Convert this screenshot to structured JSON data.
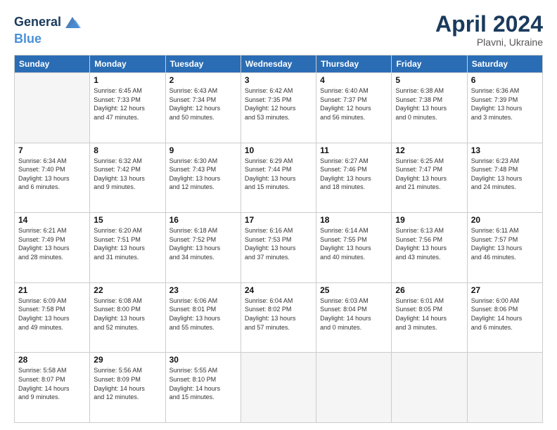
{
  "header": {
    "logo_line1": "General",
    "logo_line2": "Blue",
    "month": "April 2024",
    "location": "Plavni, Ukraine"
  },
  "weekdays": [
    "Sunday",
    "Monday",
    "Tuesday",
    "Wednesday",
    "Thursday",
    "Friday",
    "Saturday"
  ],
  "weeks": [
    [
      {
        "day": "",
        "info": ""
      },
      {
        "day": "1",
        "info": "Sunrise: 6:45 AM\nSunset: 7:33 PM\nDaylight: 12 hours\nand 47 minutes."
      },
      {
        "day": "2",
        "info": "Sunrise: 6:43 AM\nSunset: 7:34 PM\nDaylight: 12 hours\nand 50 minutes."
      },
      {
        "day": "3",
        "info": "Sunrise: 6:42 AM\nSunset: 7:35 PM\nDaylight: 12 hours\nand 53 minutes."
      },
      {
        "day": "4",
        "info": "Sunrise: 6:40 AM\nSunset: 7:37 PM\nDaylight: 12 hours\nand 56 minutes."
      },
      {
        "day": "5",
        "info": "Sunrise: 6:38 AM\nSunset: 7:38 PM\nDaylight: 13 hours\nand 0 minutes."
      },
      {
        "day": "6",
        "info": "Sunrise: 6:36 AM\nSunset: 7:39 PM\nDaylight: 13 hours\nand 3 minutes."
      }
    ],
    [
      {
        "day": "7",
        "info": "Sunrise: 6:34 AM\nSunset: 7:40 PM\nDaylight: 13 hours\nand 6 minutes."
      },
      {
        "day": "8",
        "info": "Sunrise: 6:32 AM\nSunset: 7:42 PM\nDaylight: 13 hours\nand 9 minutes."
      },
      {
        "day": "9",
        "info": "Sunrise: 6:30 AM\nSunset: 7:43 PM\nDaylight: 13 hours\nand 12 minutes."
      },
      {
        "day": "10",
        "info": "Sunrise: 6:29 AM\nSunset: 7:44 PM\nDaylight: 13 hours\nand 15 minutes."
      },
      {
        "day": "11",
        "info": "Sunrise: 6:27 AM\nSunset: 7:46 PM\nDaylight: 13 hours\nand 18 minutes."
      },
      {
        "day": "12",
        "info": "Sunrise: 6:25 AM\nSunset: 7:47 PM\nDaylight: 13 hours\nand 21 minutes."
      },
      {
        "day": "13",
        "info": "Sunrise: 6:23 AM\nSunset: 7:48 PM\nDaylight: 13 hours\nand 24 minutes."
      }
    ],
    [
      {
        "day": "14",
        "info": "Sunrise: 6:21 AM\nSunset: 7:49 PM\nDaylight: 13 hours\nand 28 minutes."
      },
      {
        "day": "15",
        "info": "Sunrise: 6:20 AM\nSunset: 7:51 PM\nDaylight: 13 hours\nand 31 minutes."
      },
      {
        "day": "16",
        "info": "Sunrise: 6:18 AM\nSunset: 7:52 PM\nDaylight: 13 hours\nand 34 minutes."
      },
      {
        "day": "17",
        "info": "Sunrise: 6:16 AM\nSunset: 7:53 PM\nDaylight: 13 hours\nand 37 minutes."
      },
      {
        "day": "18",
        "info": "Sunrise: 6:14 AM\nSunset: 7:55 PM\nDaylight: 13 hours\nand 40 minutes."
      },
      {
        "day": "19",
        "info": "Sunrise: 6:13 AM\nSunset: 7:56 PM\nDaylight: 13 hours\nand 43 minutes."
      },
      {
        "day": "20",
        "info": "Sunrise: 6:11 AM\nSunset: 7:57 PM\nDaylight: 13 hours\nand 46 minutes."
      }
    ],
    [
      {
        "day": "21",
        "info": "Sunrise: 6:09 AM\nSunset: 7:58 PM\nDaylight: 13 hours\nand 49 minutes."
      },
      {
        "day": "22",
        "info": "Sunrise: 6:08 AM\nSunset: 8:00 PM\nDaylight: 13 hours\nand 52 minutes."
      },
      {
        "day": "23",
        "info": "Sunrise: 6:06 AM\nSunset: 8:01 PM\nDaylight: 13 hours\nand 55 minutes."
      },
      {
        "day": "24",
        "info": "Sunrise: 6:04 AM\nSunset: 8:02 PM\nDaylight: 13 hours\nand 57 minutes."
      },
      {
        "day": "25",
        "info": "Sunrise: 6:03 AM\nSunset: 8:04 PM\nDaylight: 14 hours\nand 0 minutes."
      },
      {
        "day": "26",
        "info": "Sunrise: 6:01 AM\nSunset: 8:05 PM\nDaylight: 14 hours\nand 3 minutes."
      },
      {
        "day": "27",
        "info": "Sunrise: 6:00 AM\nSunset: 8:06 PM\nDaylight: 14 hours\nand 6 minutes."
      }
    ],
    [
      {
        "day": "28",
        "info": "Sunrise: 5:58 AM\nSunset: 8:07 PM\nDaylight: 14 hours\nand 9 minutes."
      },
      {
        "day": "29",
        "info": "Sunrise: 5:56 AM\nSunset: 8:09 PM\nDaylight: 14 hours\nand 12 minutes."
      },
      {
        "day": "30",
        "info": "Sunrise: 5:55 AM\nSunset: 8:10 PM\nDaylight: 14 hours\nand 15 minutes."
      },
      {
        "day": "",
        "info": ""
      },
      {
        "day": "",
        "info": ""
      },
      {
        "day": "",
        "info": ""
      },
      {
        "day": "",
        "info": ""
      }
    ]
  ]
}
